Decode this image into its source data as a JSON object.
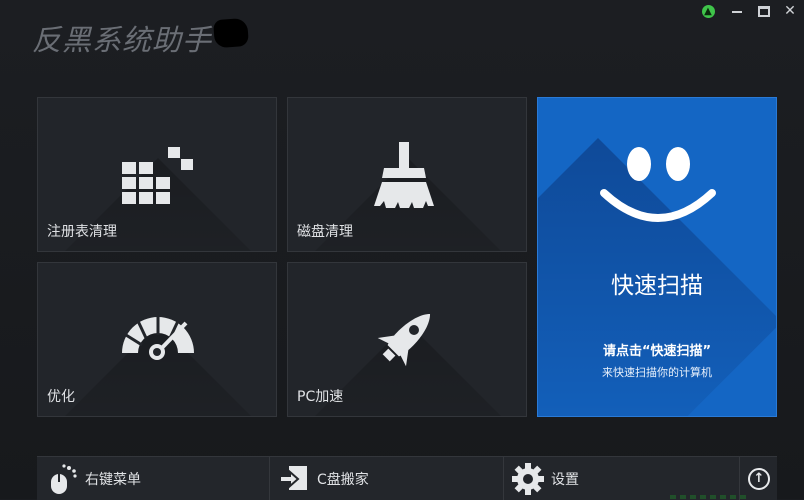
{
  "app": {
    "title": "反黑系统助手"
  },
  "window_controls": {
    "update_icon": "up-arrow-icon",
    "minimize_icon": "minimize-icon",
    "maximize_icon": "maximize-icon",
    "close_icon": "close-icon",
    "close_glyph": "✕"
  },
  "tiles": {
    "registry": {
      "label": "注册表清理",
      "icon": "grid-blocks-icon"
    },
    "disk": {
      "label": "磁盘清理",
      "icon": "broom-icon"
    },
    "optimize": {
      "label": "优化",
      "icon": "gauge-icon"
    },
    "pc_speed": {
      "label": "PC加速",
      "icon": "rocket-icon"
    }
  },
  "quick_scan": {
    "title": "快速扫描",
    "hint_title": "请点击“快速扫描”",
    "hint_sub": "来快速扫描你的计算机",
    "icon": "smiley-icon"
  },
  "bottom_bar": {
    "context_menu": {
      "label": "右键菜单",
      "icon": "mouse-icon"
    },
    "c_drive_move": {
      "label": "C盘搬家",
      "icon": "transfer-icon"
    },
    "settings": {
      "label": "设置",
      "icon": "gear-icon"
    },
    "scroll_up_icon": "circle-up-arrow-icon",
    "scroll_up_glyph": "↑"
  },
  "colors": {
    "accent_blue": "#1466c4",
    "tile_bg": "#22252a",
    "update_green": "#3fc44a"
  }
}
